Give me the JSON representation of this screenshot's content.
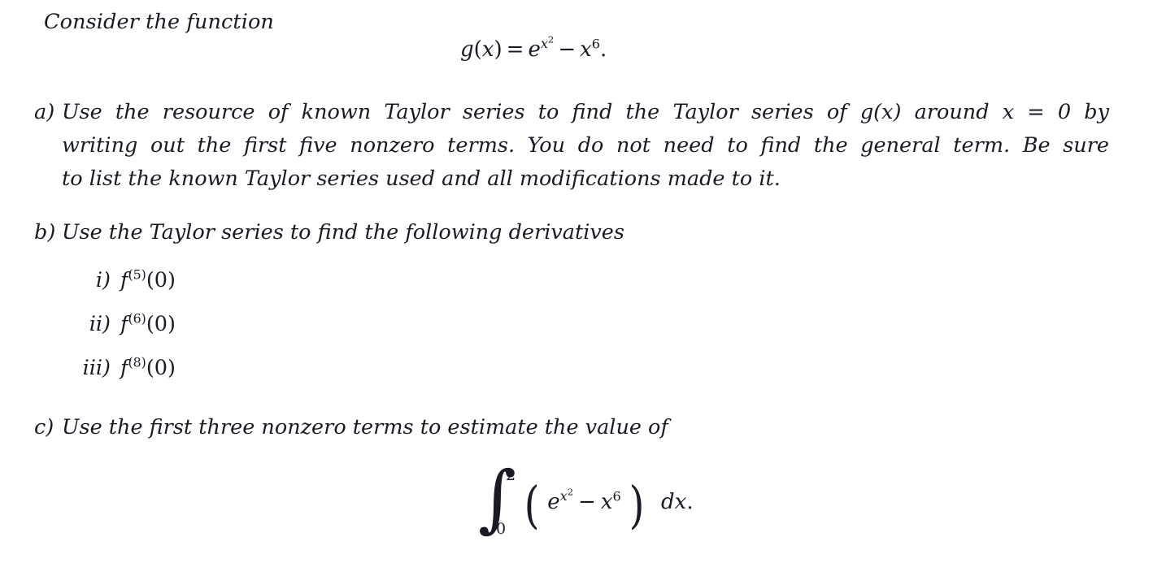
{
  "document": {
    "background_color": "#ffffff",
    "text_color": "#1a1a24",
    "intro_line": "Consider the function"
  },
  "display_equation_1": {
    "lhs_function": "g",
    "lhs_variable": "x",
    "equals": "=",
    "exp_base": "e",
    "exp_superscript_base": "x",
    "exp_superscript_exponent": "2",
    "minus": "−",
    "term2_base": "x",
    "term2_exponent": "6",
    "period": "."
  },
  "items": [
    {
      "marker": "a)",
      "lines": [
        "Use the resource of known Taylor series to find the Taylor series of g(x) around x = 0 by",
        "writing out the first five nonzero terms.  You do not need to find the general term.  Be sure",
        "to list the known Taylor series used and all modifications made to it."
      ],
      "line1_before_math": "Use the resource of known Taylor series to find the Taylor series of",
      "line1_math_g": "g",
      "line1_math_gvar": "x",
      "line1_mid": "around",
      "line1_math_x": "x",
      "line1_math_eq": "=",
      "line1_math_zero": "0",
      "line1_after": "by"
    },
    {
      "marker": "b)",
      "lines": [
        "Use the Taylor series to find the following derivatives"
      ]
    },
    {
      "marker": "c)",
      "lines": [
        "Use the first three nonzero terms to estimate the value of"
      ]
    }
  ],
  "subitems": [
    {
      "marker": "i)",
      "function": "f",
      "order": "(5)",
      "argument": "(0)"
    },
    {
      "marker": "ii)",
      "function": "f",
      "order": "(6)",
      "argument": "(0)"
    },
    {
      "marker": "iii)",
      "function": "f",
      "order": "(8)",
      "argument": "(0)"
    }
  ],
  "display_equation_2": {
    "integral_sign": "∫",
    "upper_limit": "2",
    "lower_limit": "0",
    "open_paren": "(",
    "close_paren": ")",
    "exp_base": "e",
    "exp_superscript_base": "x",
    "exp_superscript_exponent": "2",
    "minus": "−",
    "term2_base": "x",
    "term2_exponent": "6",
    "differential": "dx",
    "period": "."
  }
}
